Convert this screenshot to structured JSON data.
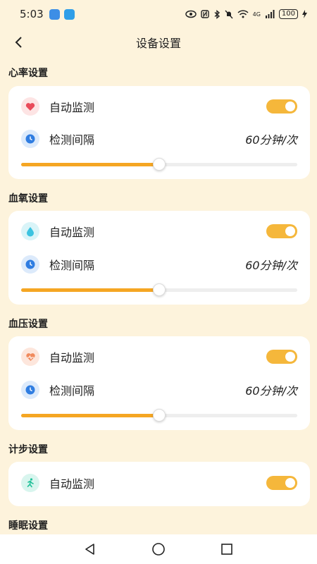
{
  "status_bar": {
    "time": "5:03",
    "signal": "4G",
    "battery": "100"
  },
  "header": {
    "title": "设备设置"
  },
  "sections": [
    {
      "title": "心率设置",
      "auto_label": "自动监测",
      "auto_on": true,
      "interval_label": "检测间隔",
      "interval_value": "60分钟/次",
      "slider_fraction": 0.5,
      "icon": "heart-icon",
      "icon_color": "#e94b5a"
    },
    {
      "title": "血氧设置",
      "auto_label": "自动监测",
      "auto_on": true,
      "interval_label": "检测间隔",
      "interval_value": "60分钟/次",
      "slider_fraction": 0.5,
      "icon": "droplet-icon",
      "icon_color": "#3cc3e0"
    },
    {
      "title": "血压设置",
      "auto_label": "自动监测",
      "auto_on": true,
      "interval_label": "检测间隔",
      "interval_value": "60分钟/次",
      "slider_fraction": 0.5,
      "icon": "pulse-heart-icon",
      "icon_color": "#f08a5d"
    },
    {
      "title": "计步设置",
      "auto_label": "自动监测",
      "auto_on": true,
      "icon": "runner-icon",
      "icon_color": "#23c29a"
    },
    {
      "title": "睡眠设置"
    }
  ],
  "colors": {
    "background": "#fdf3dc",
    "accent": "#f5a623",
    "toggle_on": "#f5b73b",
    "clock_icon": "#2f7de1"
  }
}
